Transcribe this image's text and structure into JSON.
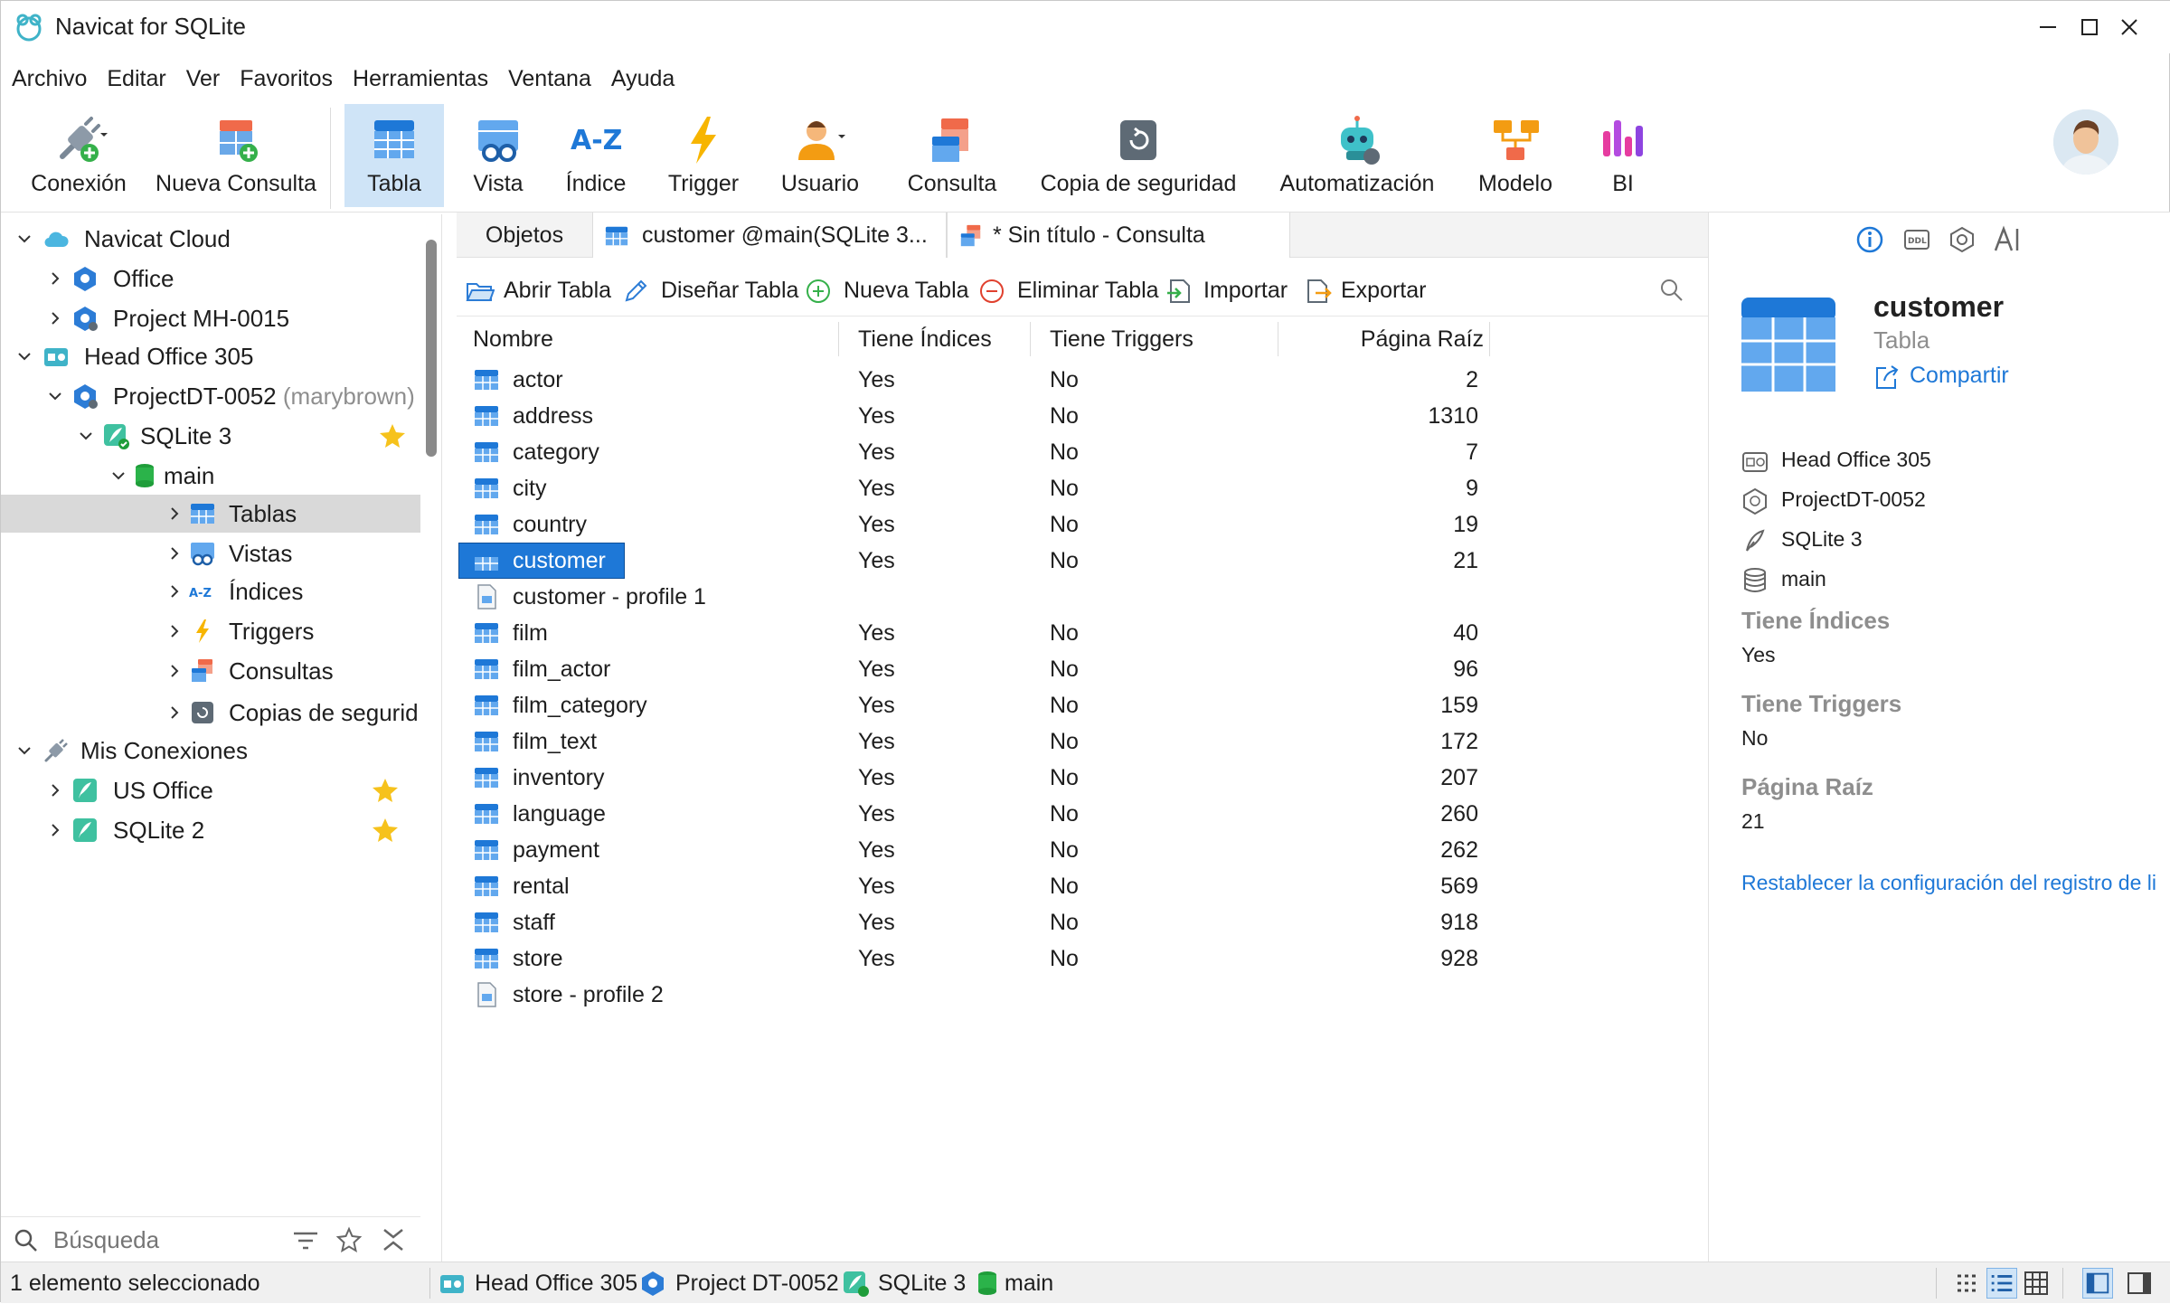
{
  "window": {
    "title": "Navicat for SQLite"
  },
  "menu": [
    "Archivo",
    "Editar",
    "Ver",
    "Favoritos",
    "Herramientas",
    "Ventana",
    "Ayuda"
  ],
  "toolbar": {
    "conexion": "Conexión",
    "nueva_consulta": "Nueva Consulta",
    "tabla": "Tabla",
    "vista": "Vista",
    "indice": "Índice",
    "trigger": "Trigger",
    "usuario": "Usuario",
    "consulta": "Consulta",
    "copia": "Copia de seguridad",
    "automatizacion": "Automatización",
    "modelo": "Modelo",
    "bi": "BI"
  },
  "tree": {
    "navicat_cloud": "Navicat Cloud",
    "office": "Office",
    "project_mh": "Project MH-0015",
    "head_office": "Head Office 305",
    "project_dt": "ProjectDT-0052",
    "project_dt_owner": "(marybrown)",
    "sqlite3": "SQLite 3",
    "main": "main",
    "tablas": "Tablas",
    "vistas": "Vistas",
    "indices": "Índices",
    "triggers": "Triggers",
    "consultas": "Consultas",
    "copias": "Copias de segurid",
    "mis_conexiones": "Mis Conexiones",
    "us_office": "US Office",
    "sqlite2": "SQLite 2"
  },
  "search": {
    "placeholder": "Búsqueda"
  },
  "tabs": {
    "objetos": "Objetos",
    "customer": "customer @main(SQLite 3...",
    "sin_titulo": "* Sin título - Consulta"
  },
  "actions": {
    "abrir": "Abrir Tabla",
    "disenar": "Diseñar Tabla",
    "nueva": "Nueva Tabla",
    "eliminar": "Eliminar Tabla",
    "importar": "Importar",
    "exportar": "Exportar"
  },
  "columns": {
    "nombre": "Nombre",
    "indices": "Tiene Índices",
    "triggers": "Tiene Triggers",
    "pagina": "Página Raíz"
  },
  "rows": [
    {
      "name": "actor",
      "idx": "Yes",
      "trg": "No",
      "page": "2",
      "kind": "table"
    },
    {
      "name": "address",
      "idx": "Yes",
      "trg": "No",
      "page": "1310",
      "kind": "table"
    },
    {
      "name": "category",
      "idx": "Yes",
      "trg": "No",
      "page": "7",
      "kind": "table"
    },
    {
      "name": "city",
      "idx": "Yes",
      "trg": "No",
      "page": "9",
      "kind": "table"
    },
    {
      "name": "country",
      "idx": "Yes",
      "trg": "No",
      "page": "19",
      "kind": "table"
    },
    {
      "name": "customer",
      "idx": "Yes",
      "trg": "No",
      "page": "21",
      "kind": "table"
    },
    {
      "name": "customer - profile 1",
      "idx": "",
      "trg": "",
      "page": "",
      "kind": "profile"
    },
    {
      "name": "film",
      "idx": "Yes",
      "trg": "No",
      "page": "40",
      "kind": "table"
    },
    {
      "name": "film_actor",
      "idx": "Yes",
      "trg": "No",
      "page": "96",
      "kind": "table"
    },
    {
      "name": "film_category",
      "idx": "Yes",
      "trg": "No",
      "page": "159",
      "kind": "table"
    },
    {
      "name": "film_text",
      "idx": "Yes",
      "trg": "No",
      "page": "172",
      "kind": "table"
    },
    {
      "name": "inventory",
      "idx": "Yes",
      "trg": "No",
      "page": "207",
      "kind": "table"
    },
    {
      "name": "language",
      "idx": "Yes",
      "trg": "No",
      "page": "260",
      "kind": "table"
    },
    {
      "name": "payment",
      "idx": "Yes",
      "trg": "No",
      "page": "262",
      "kind": "table"
    },
    {
      "name": "rental",
      "idx": "Yes",
      "trg": "No",
      "page": "569",
      "kind": "table"
    },
    {
      "name": "staff",
      "idx": "Yes",
      "trg": "No",
      "page": "918",
      "kind": "table"
    },
    {
      "name": "store",
      "idx": "Yes",
      "trg": "No",
      "page": "928",
      "kind": "table"
    },
    {
      "name": "store - profile 2",
      "idx": "",
      "trg": "",
      "page": "",
      "kind": "profile"
    }
  ],
  "selected_row": "customer",
  "info": {
    "name": "customer",
    "type": "Tabla",
    "share": "Compartir",
    "loc_server": "Head Office 305",
    "loc_project": "ProjectDT-0052",
    "loc_conn": "SQLite 3",
    "loc_db": "main",
    "k_indices": "Tiene Índices",
    "v_indices": "Yes",
    "k_triggers": "Tiene Triggers",
    "v_triggers": "No",
    "k_pagina": "Página Raíz",
    "v_pagina": "21",
    "reset": "Restablecer la configuración del registro de li"
  },
  "status": {
    "selection": "1 elemento seleccionado",
    "server": "Head Office 305",
    "project": "Project DT-0052",
    "conn": "SQLite 3",
    "db": "main"
  },
  "colors": {
    "accent": "#1e78d7",
    "selection": "#cfe4f7",
    "star": "#f6c21c"
  }
}
